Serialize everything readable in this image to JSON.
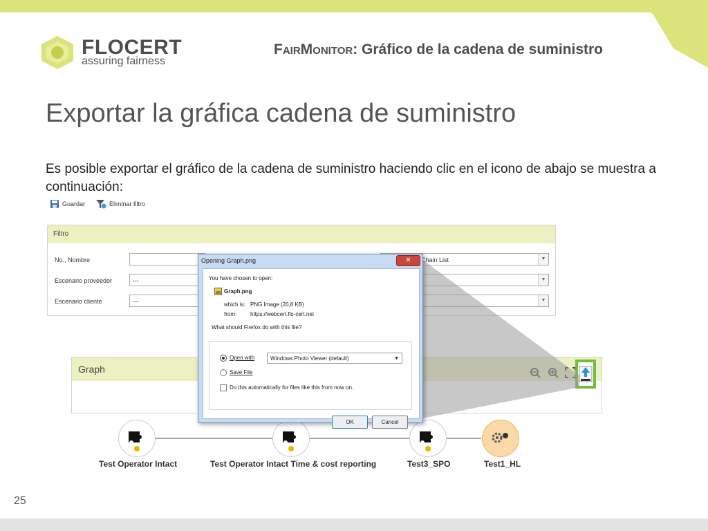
{
  "header": {
    "logo_text": "FLOCERT",
    "logo_tagline": "assuring fairness",
    "section_title_sc": "FairMonitor",
    "section_title_rest": ": Gráfico de la cadena de suministro"
  },
  "slide": {
    "title": "Exportar la gráfica cadena de suministro",
    "description": "Es posible exportar el gráfico de la cadena de suministro haciendo clic en el icono de abajo se muestra a continuación:",
    "page_number": "25"
  },
  "toolbar": {
    "save_label": "Guardar",
    "remove_filter_label": "Eliminar filtro"
  },
  "filter": {
    "title": "Filtro",
    "rows": [
      {
        "label": "No., Nombre",
        "value": ""
      },
      {
        "label": "Escenario proveedor",
        "value": "---"
      },
      {
        "label": "Escenario cliente",
        "value": "---"
      }
    ],
    "select_visible": "Chain List"
  },
  "graph": {
    "title": "Graph",
    "nodes": [
      {
        "label": "Test Operator Intact"
      },
      {
        "label": "Test Operator Intact Time & cost reporting"
      },
      {
        "label": "Test3_SPO"
      },
      {
        "label": "Test1_HL"
      }
    ]
  },
  "dialog": {
    "title": "Opening Graph.png",
    "close": "✕",
    "chosen_text": "You have chosen to open:",
    "filename": "Graph.png",
    "which_is_label": "which is:",
    "which_is_value": "PNG Image (20,8 KB)",
    "from_label": "from:",
    "from_value": "https://webcert.flo-cert.net",
    "question": "What should Firefox do with this file?",
    "open_with_label": "Open with",
    "open_with_app": "Windows Photo Viewer (default)",
    "save_file_label": "Save File",
    "auto_label": "Do this automatically for files like this from now on.",
    "ok": "OK",
    "cancel": "Cancel"
  },
  "colors": {
    "accent_lime": "#dbe37a",
    "panel_header": "#edf0c0",
    "highlight_green": "#6ebf3a",
    "node_active": "#f9d9a6",
    "dot_yellow": "#f0b400"
  }
}
